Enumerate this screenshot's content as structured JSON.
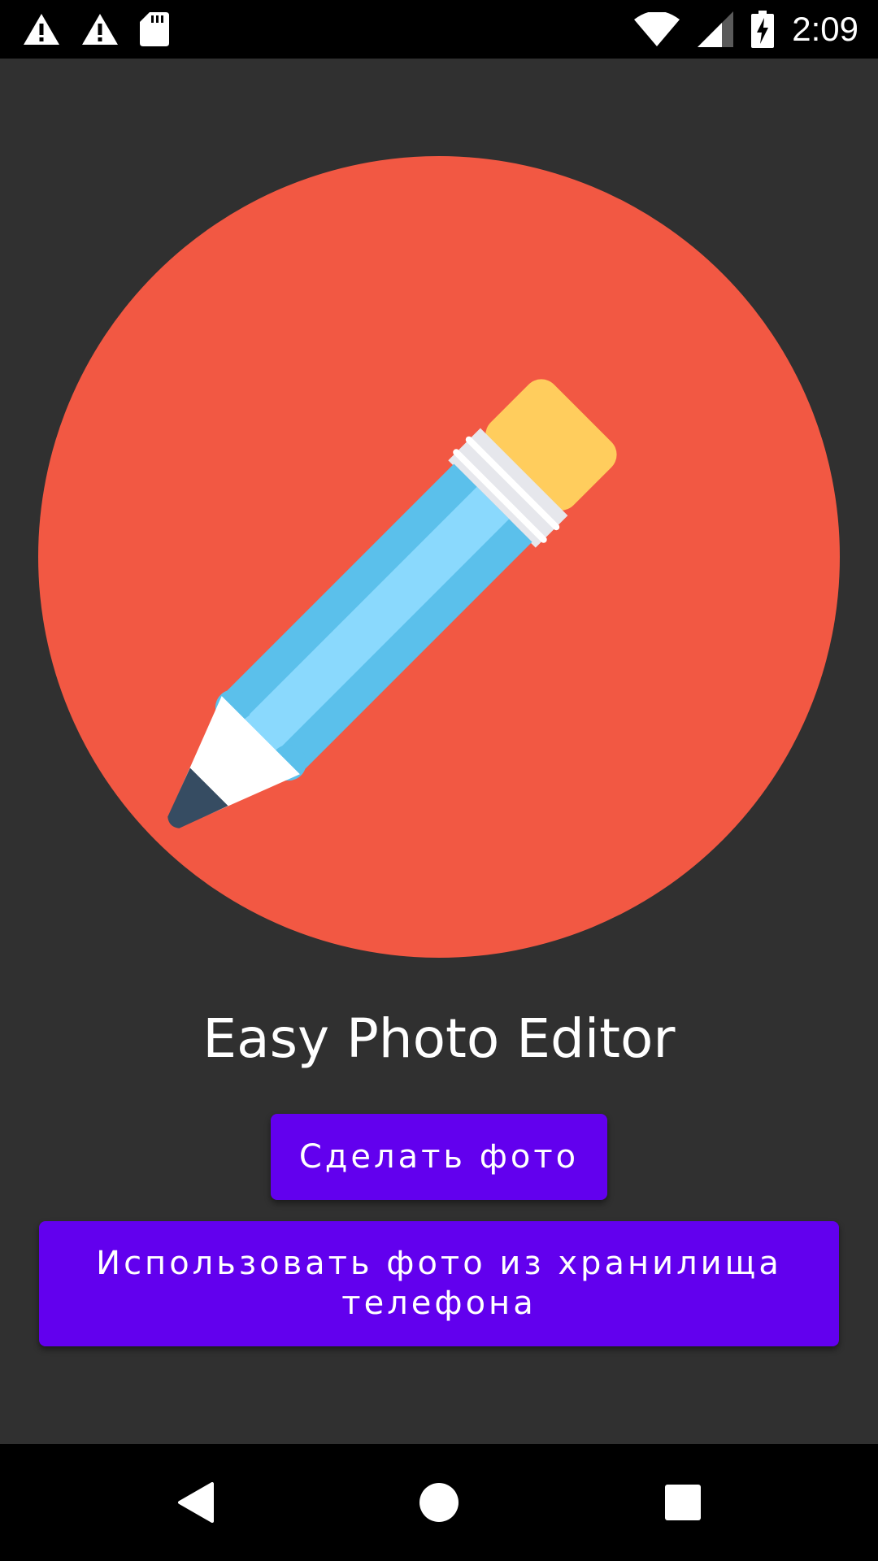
{
  "status_bar": {
    "time": "2:09",
    "left_icons": [
      "warning-icon",
      "warning-icon",
      "sd-card-icon"
    ],
    "right_icons": [
      "wifi-icon",
      "cell-signal-icon",
      "battery-charging-icon"
    ]
  },
  "logo": {
    "icon": "pencil-icon",
    "colors": {
      "circle": "#f25843",
      "pencil_body": "#5bc0eb",
      "pencil_light": "#8ad9fd",
      "eraser": "#ffcd5d",
      "ferrule": "#e6e7ec",
      "tip_wood": "#ffffff",
      "lead": "#364c62"
    }
  },
  "title": "Easy Photo Editor",
  "buttons": {
    "take_photo": "Сделать фото",
    "use_gallery": "Использовать фото из хранилища телефона"
  },
  "nav_bar": {
    "icons": [
      "back-icon",
      "home-icon",
      "recents-icon"
    ]
  },
  "theme": {
    "background": "#303030",
    "button": "#6200ee",
    "bars": "#000000"
  }
}
